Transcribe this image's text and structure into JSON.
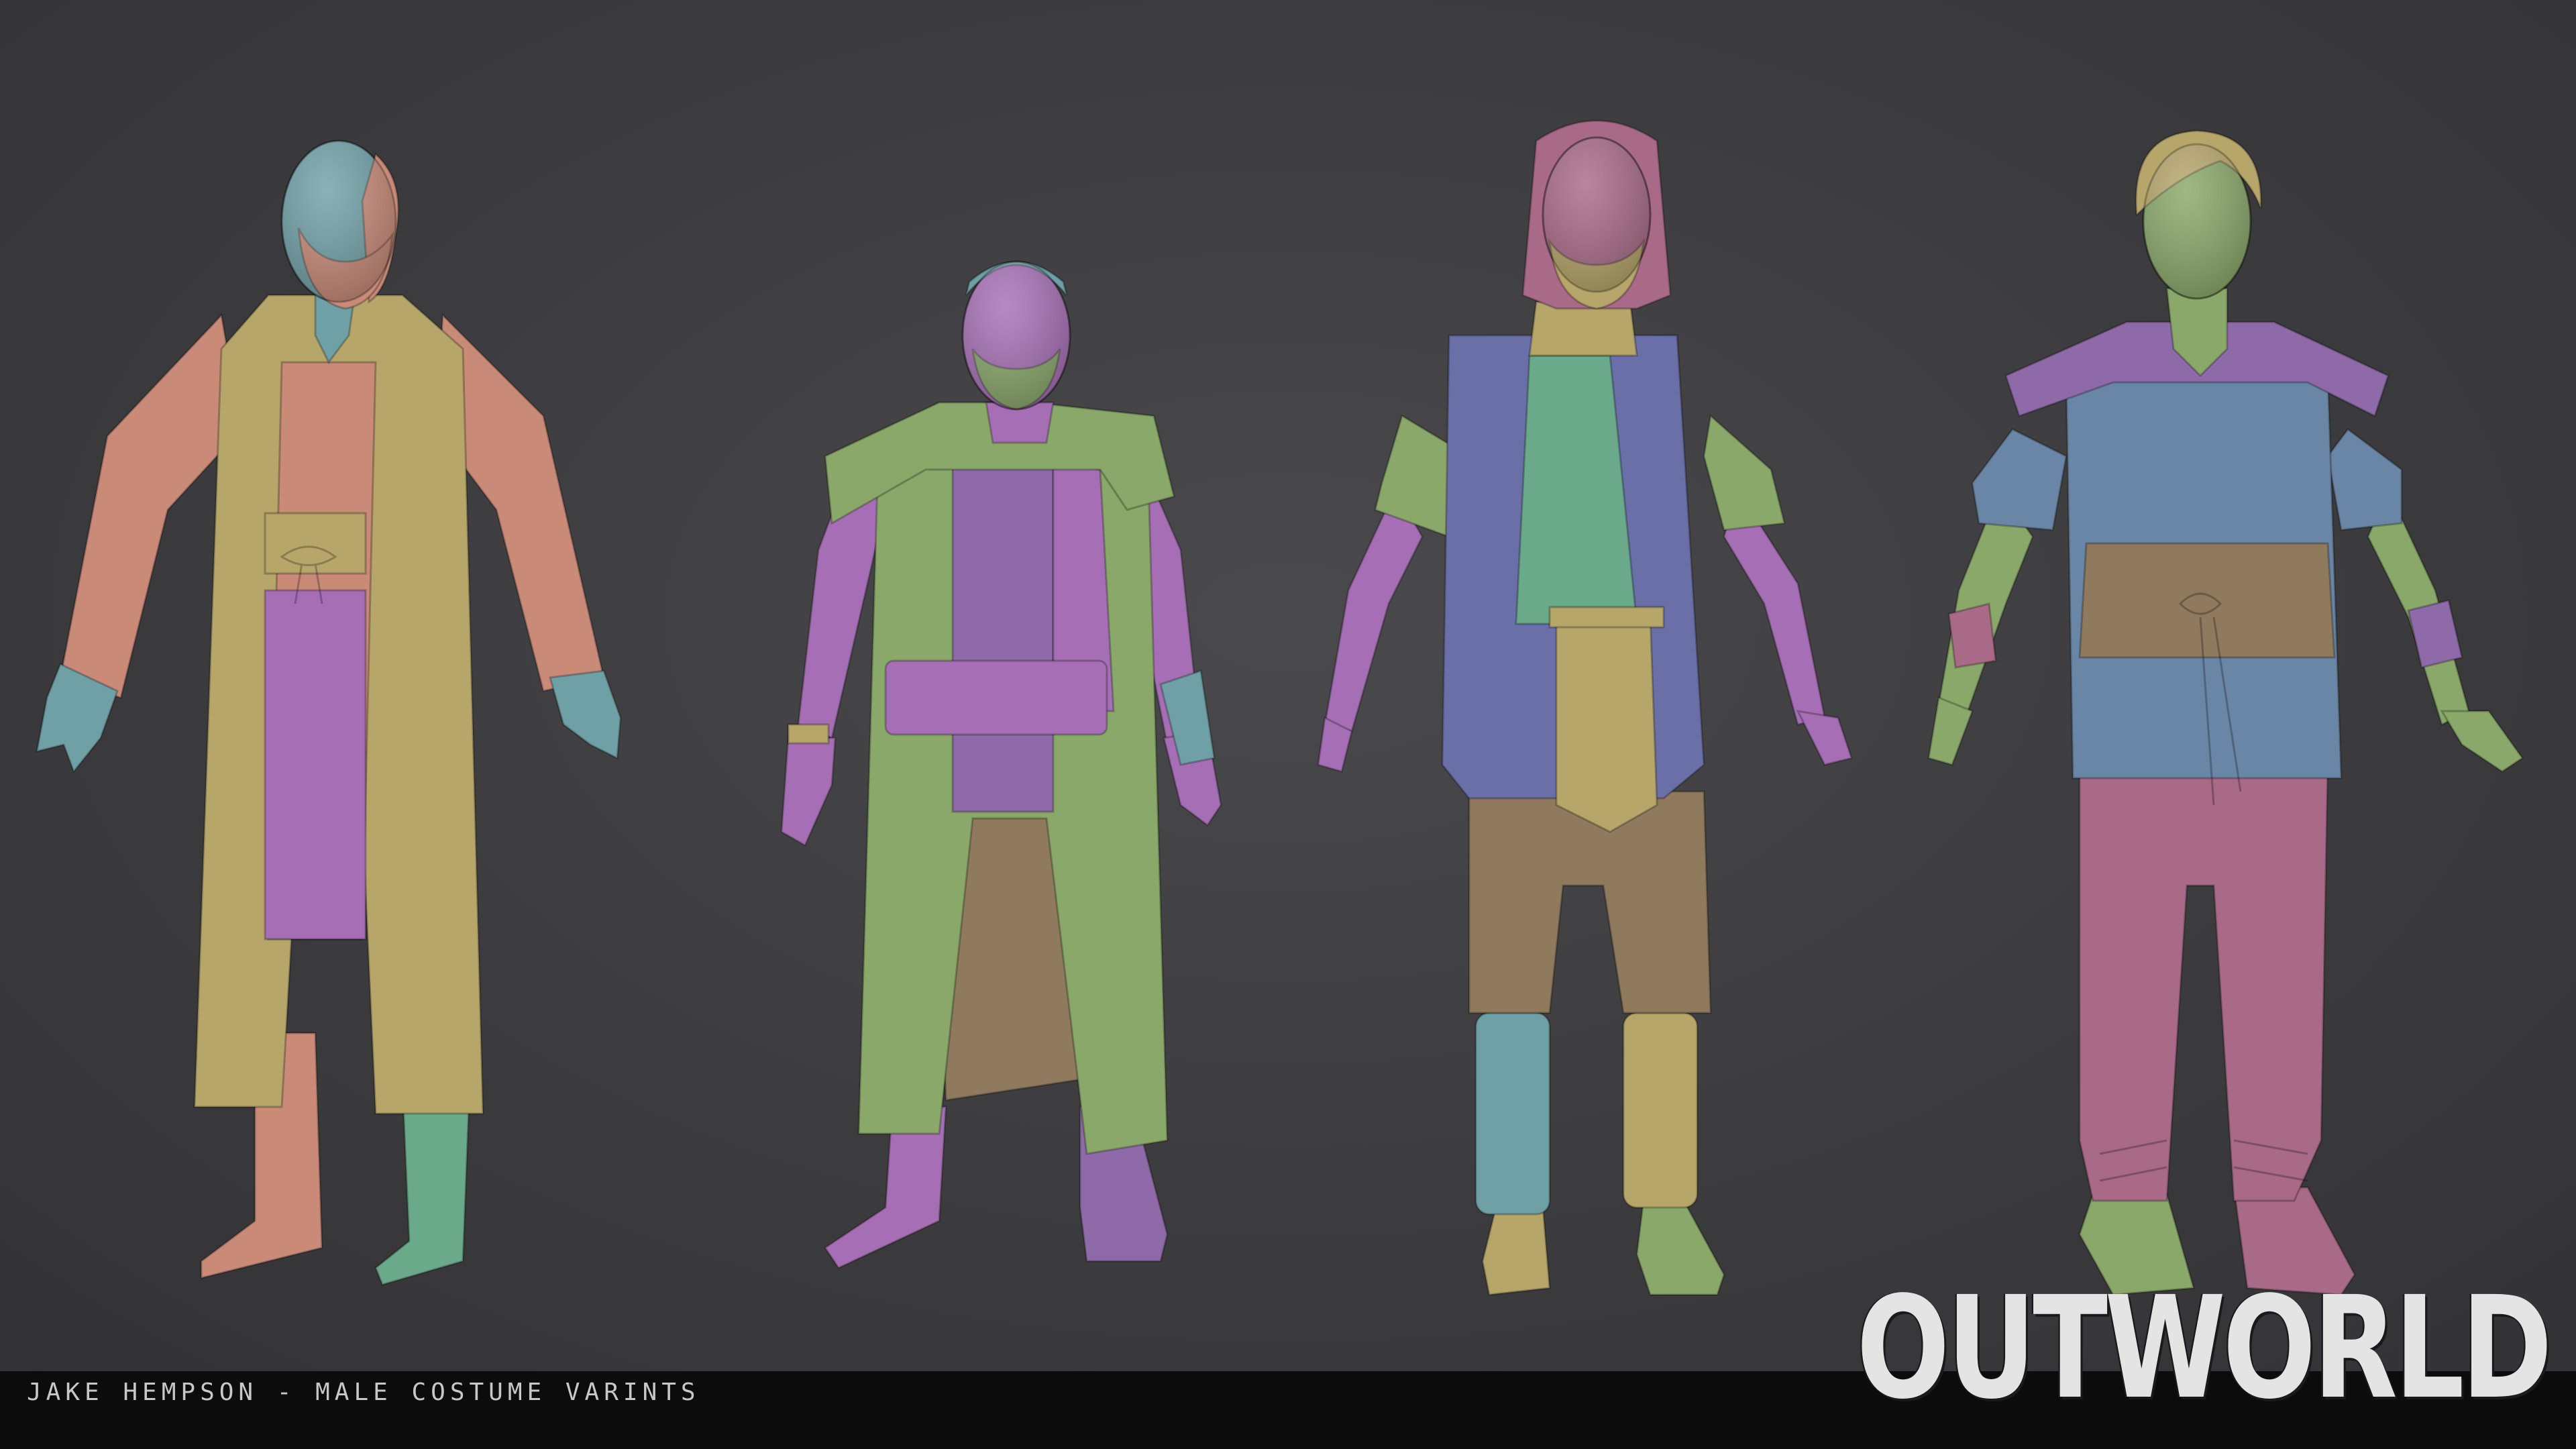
{
  "caption": "JAKE HEMPSON - MALE COSTUME VARINTS",
  "logo": "OUTWORLD",
  "colors": {
    "background": "#3a3a3c",
    "caption_bar": "#0c0c0c",
    "skin_teal": "#6fa0a6",
    "salmon": "#c98a78",
    "khaki": "#b7a66a",
    "lavender": "#8f6aa8",
    "purple": "#a66fb5",
    "green": "#8aa86a",
    "mint": "#6aa98a",
    "slate_blue": "#6a6fa8",
    "tan": "#8f7a5e",
    "blue_grey": "#6a86a6",
    "mauve": "#a86a86"
  },
  "figures": [
    {
      "name": "figure-1-robed-elder"
    },
    {
      "name": "figure-2-stout-tunic"
    },
    {
      "name": "figure-3-hooded-traveler"
    },
    {
      "name": "figure-4-young-caped"
    }
  ]
}
